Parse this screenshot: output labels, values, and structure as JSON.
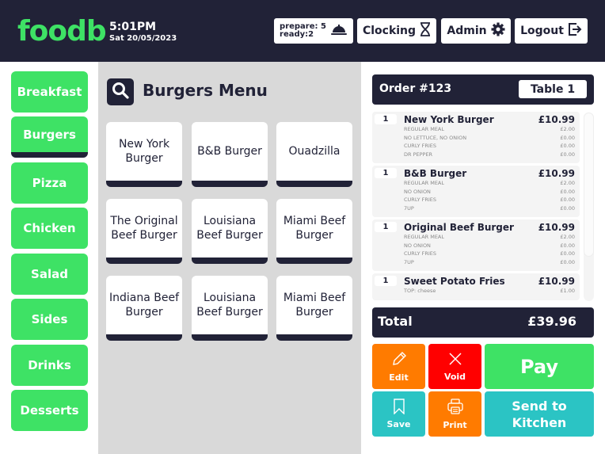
{
  "header": {
    "logo": "foodb",
    "time": "5:01PM",
    "date": "Sat 20/05/2023",
    "orders_status": {
      "prepare": "prepare: 5",
      "ready": "ready:2",
      "icon": "service-bell-icon"
    },
    "clocking_label": "Clocking",
    "admin_label": "Admin",
    "logout_label": "Logout"
  },
  "sidebar": {
    "categories": [
      {
        "label": "Breakfast",
        "active": false
      },
      {
        "label": "Burgers",
        "active": true
      },
      {
        "label": "Pizza",
        "active": false
      },
      {
        "label": "Chicken",
        "active": false
      },
      {
        "label": "Salad",
        "active": false
      },
      {
        "label": "Sides",
        "active": false
      },
      {
        "label": "Drinks",
        "active": false
      },
      {
        "label": "Desserts",
        "active": false
      }
    ]
  },
  "menu": {
    "title": "Burgers Menu",
    "items": [
      "New York Burger",
      "B&B Burger",
      "Ouadzilla",
      "The Original Beef Burger",
      "Louisiana Beef Burger",
      "Miami Beef Burger",
      "Indiana Beef Burger",
      "Louisiana Beef Burger",
      "Miami Beef Burger"
    ]
  },
  "order": {
    "number": "Order #123",
    "table": "Table 1",
    "items": [
      {
        "qty": "1",
        "name": "New York Burger",
        "price": "£10.99",
        "mods": [
          [
            "REGULAR MEAL",
            "£2.00"
          ],
          [
            "NO LETTUCE, NO ONION",
            "£0.00"
          ],
          [
            "CURLY FRIES",
            "£0.00"
          ],
          [
            "DR PEPPER",
            "£0.00"
          ]
        ]
      },
      {
        "qty": "1",
        "name": "B&B Burger",
        "price": "£10.99",
        "mods": [
          [
            "REGULAR MEAL",
            "£2.00"
          ],
          [
            "NO ONION",
            "£0.00"
          ],
          [
            "CURLY FRIES",
            "£0.00"
          ],
          [
            "7UP",
            "£0.00"
          ]
        ]
      },
      {
        "qty": "1",
        "name": "Original Beef Burger",
        "price": "£10.99",
        "mods": [
          [
            "REGULAR MEAL",
            "£2.00"
          ],
          [
            "NO ONION",
            "£0.00"
          ],
          [
            "CURLY FRIES",
            "£0.00"
          ],
          [
            "7UP",
            "£0.00"
          ]
        ]
      },
      {
        "qty": "1",
        "name": "Sweet Potato Fries",
        "price": "£10.99",
        "mods": [
          [
            "TOP: cheese",
            "£1.00"
          ]
        ]
      }
    ],
    "total_label": "Total",
    "total_value": "£39.96"
  },
  "actions": {
    "edit": "Edit",
    "void": "Void",
    "pay": "Pay",
    "save": "Save",
    "print": "Print",
    "send": "Send to Kitchen"
  },
  "colors": {
    "navy": "#212237",
    "green": "#3ee265",
    "orange": "#ff7b00",
    "red": "#ff0000",
    "teal": "#2bc4c4"
  }
}
